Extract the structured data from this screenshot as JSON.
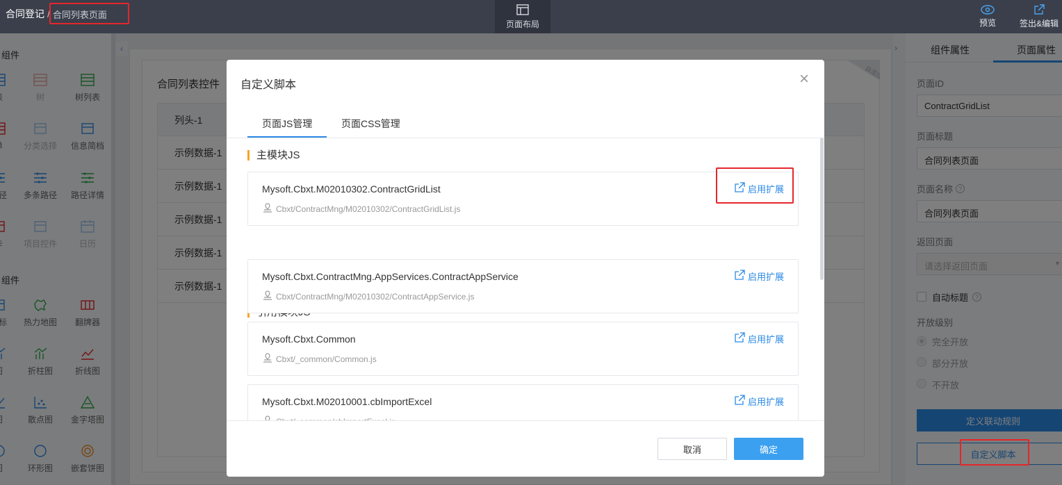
{
  "topbar": {
    "breadcrumb_root": "合同登记",
    "breadcrumb_sep": "/",
    "breadcrumb_current": "合同列表页面",
    "layout_label": "页面布局",
    "preview_label": "预览",
    "checkout_label": "签出&编辑"
  },
  "palette": {
    "group1_title": "组件",
    "group2_title": "组件",
    "items": [
      {
        "label": "表",
        "icon": "table-icon",
        "disabled": false
      },
      {
        "label": "树",
        "icon": "tree-icon",
        "disabled": true
      },
      {
        "label": "树列表",
        "icon": "tree-list-icon",
        "disabled": false
      },
      {
        "label": "单",
        "icon": "form-icon",
        "disabled": false
      },
      {
        "label": "分类选择",
        "icon": "category-select-icon",
        "disabled": true
      },
      {
        "label": "信息简档",
        "icon": "info-card-icon",
        "disabled": false
      },
      {
        "label": "路径",
        "icon": "path-icon",
        "disabled": false
      },
      {
        "label": "多条路径",
        "icon": "multi-path-icon",
        "disabled": false
      },
      {
        "label": "路径详情",
        "icon": "path-detail-icon",
        "disabled": false
      },
      {
        "label": "卡",
        "icon": "card-icon",
        "disabled": false
      },
      {
        "label": "项目控件",
        "icon": "project-control-icon",
        "disabled": true
      },
      {
        "label": "日历",
        "icon": "calendar-icon",
        "disabled": true
      },
      {
        "label": "指标",
        "icon": "indicator-icon",
        "disabled": false
      },
      {
        "label": "热力地图",
        "icon": "heat-map-icon",
        "disabled": false
      },
      {
        "label": "翻牌器",
        "icon": "flip-counter-icon",
        "disabled": false
      },
      {
        "label": "图",
        "icon": "bar-chart-icon",
        "disabled": false
      },
      {
        "label": "折柱图",
        "icon": "bar-line-chart-icon",
        "disabled": false
      },
      {
        "label": "折线图",
        "icon": "line-chart-icon",
        "disabled": false
      },
      {
        "label": "图",
        "icon": "area-chart-icon",
        "disabled": false
      },
      {
        "label": "散点图",
        "icon": "scatter-chart-icon",
        "disabled": false
      },
      {
        "label": "金字塔图",
        "icon": "pyramid-chart-icon",
        "disabled": false
      },
      {
        "label": "图",
        "icon": "pie-chart-icon",
        "disabled": false
      },
      {
        "label": "环形图",
        "icon": "ring-chart-icon",
        "disabled": false
      },
      {
        "label": "嵌套饼图",
        "icon": "nested-pie-icon",
        "disabled": false
      }
    ]
  },
  "canvas": {
    "control_title": "合同列表控件",
    "corner_tag": "自适应",
    "header_cell": "列头-1",
    "rows": [
      "示例数据-1",
      "示例数据-1",
      "示例数据-1",
      "示例数据-1",
      "示例数据-1"
    ]
  },
  "right_panel": {
    "tab_component": "组件属性",
    "tab_page": "页面属性",
    "page_id_label": "页面ID",
    "page_id_value": "ContractGridList",
    "page_title_label": "页面标题",
    "page_title_value": "合同列表页面",
    "page_name_label": "页面名称",
    "page_name_value": "合同列表页面",
    "return_page_label": "返回页面",
    "return_page_placeholder": "请选择返回页面",
    "auto_title_label": "自动标题",
    "open_level_label": "开放级别",
    "open_levels": [
      "完全开放",
      "部分开放",
      "不开放"
    ],
    "btn_linkage": "定义联动规则",
    "btn_script": "自定义脚本"
  },
  "modal": {
    "title": "自定义脚本",
    "tabs": [
      "页面JS管理",
      "页面CSS管理"
    ],
    "main_section_title": "主模块JS",
    "ref_section_title": "引用模块JS",
    "action_label": "启用扩展",
    "main_module": {
      "name": "Mysoft.Cbxt.M02010302.ContractGridList",
      "path": "Cbxt/ContractMng/M02010302/ContractGridList.js"
    },
    "ref_modules": [
      {
        "name": "Mysoft.Cbxt.ContractMng.AppServices.ContractAppService",
        "path": "Cbxt/ContractMng/M02010302/ContractAppService.js"
      },
      {
        "name": "Mysoft.Cbxt.Common",
        "path": "Cbxt/_common/Common.js"
      },
      {
        "name": "Mysoft.Cbxt.M02010001.cbImportExcel",
        "path": "Cbxt/_common/cbImportExcel.js"
      }
    ],
    "cancel_label": "取消",
    "ok_label": "确定"
  },
  "colors": {
    "accent": "#2b8ae6",
    "highlight_box": "#e5262b",
    "section_marker": "#f5a623"
  }
}
